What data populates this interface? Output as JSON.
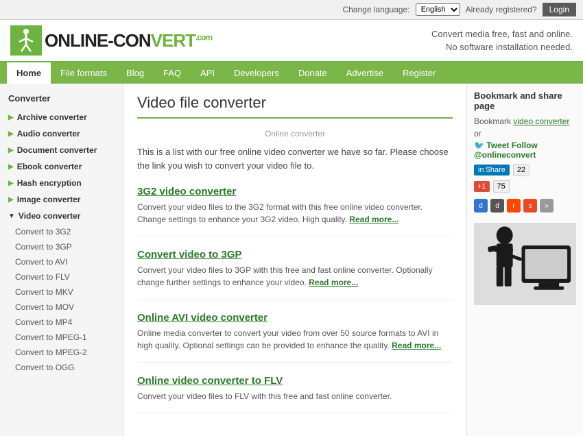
{
  "topbar": {
    "change_language_label": "Change language:",
    "language_default": "English",
    "already_registered": "Already registered?",
    "login_label": "Login"
  },
  "header": {
    "logo_text": "ONLINE-CON",
    "logo_text2": "VERT",
    "logo_com": ".com",
    "tagline_line1": "Convert media free, fast and online.",
    "tagline_line2": "No software installation needed."
  },
  "nav": {
    "items": [
      {
        "label": "Home",
        "active": true
      },
      {
        "label": "File formats",
        "active": false
      },
      {
        "label": "Blog",
        "active": false
      },
      {
        "label": "FAQ",
        "active": false
      },
      {
        "label": "API",
        "active": false
      },
      {
        "label": "Developers",
        "active": false
      },
      {
        "label": "Donate",
        "active": false
      },
      {
        "label": "Advertise",
        "active": false
      },
      {
        "label": "Register",
        "active": false
      }
    ]
  },
  "sidebar": {
    "title": "Converter",
    "categories": [
      {
        "label": "Archive converter",
        "open": false
      },
      {
        "label": "Audio converter",
        "open": false
      },
      {
        "label": "Document converter",
        "open": false
      },
      {
        "label": "Ebook converter",
        "open": false
      },
      {
        "label": "Hash encryption",
        "open": false
      },
      {
        "label": "Image converter",
        "open": false
      },
      {
        "label": "Video converter",
        "open": true
      }
    ],
    "video_subitems": [
      "Convert to 3G2",
      "Convert to 3GP",
      "Convert to AVI",
      "Convert to FLV",
      "Convert to MKV",
      "Convert to MOV",
      "Convert to MP4",
      "Convert to MPEG-1",
      "Convert to MPEG-2",
      "Convert to OGG"
    ]
  },
  "content": {
    "page_title": "Video file converter",
    "online_converter_label": "Online converter",
    "intro_text": "This is a list with our free online video converter we have so far. Please choose the link you wish to convert your video file to.",
    "converters": [
      {
        "title": "3G2 video converter",
        "description": "Convert your video files to the 3G2 format with this free online video converter. Change settings to enhance your 3G2 video. High quality.",
        "read_more": "Read more..."
      },
      {
        "title": "Convert video to 3GP",
        "description": "Convert your video files to 3GP with this free and fast online converter. Optionally change further settings to enhance your video.",
        "read_more": "Read more..."
      },
      {
        "title": "Online AVI video converter",
        "description": "Online media converter to convert your video from over 50 source formats to AVI in high quality. Optional settings can be provided to enhance the quality.",
        "read_more": "Read more..."
      },
      {
        "title": "Online video converter to FLV",
        "description": "Convert your video files to FLV with this free and fast online converter.",
        "read_more": "Read more..."
      }
    ]
  },
  "right_sidebar": {
    "bookmark_title": "Bookmark and share page",
    "bookmark_text": "Bookmark",
    "bookmark_link": "video converter",
    "or_text": "or",
    "tweet_text": "Tweet Follow @onlineconvert",
    "linkedin_label": "in Share",
    "linkedin_count": "22",
    "gplus_label": "+1",
    "gplus_count": "75",
    "social_icons": [
      "d",
      "d",
      "r",
      "s",
      "»"
    ]
  }
}
